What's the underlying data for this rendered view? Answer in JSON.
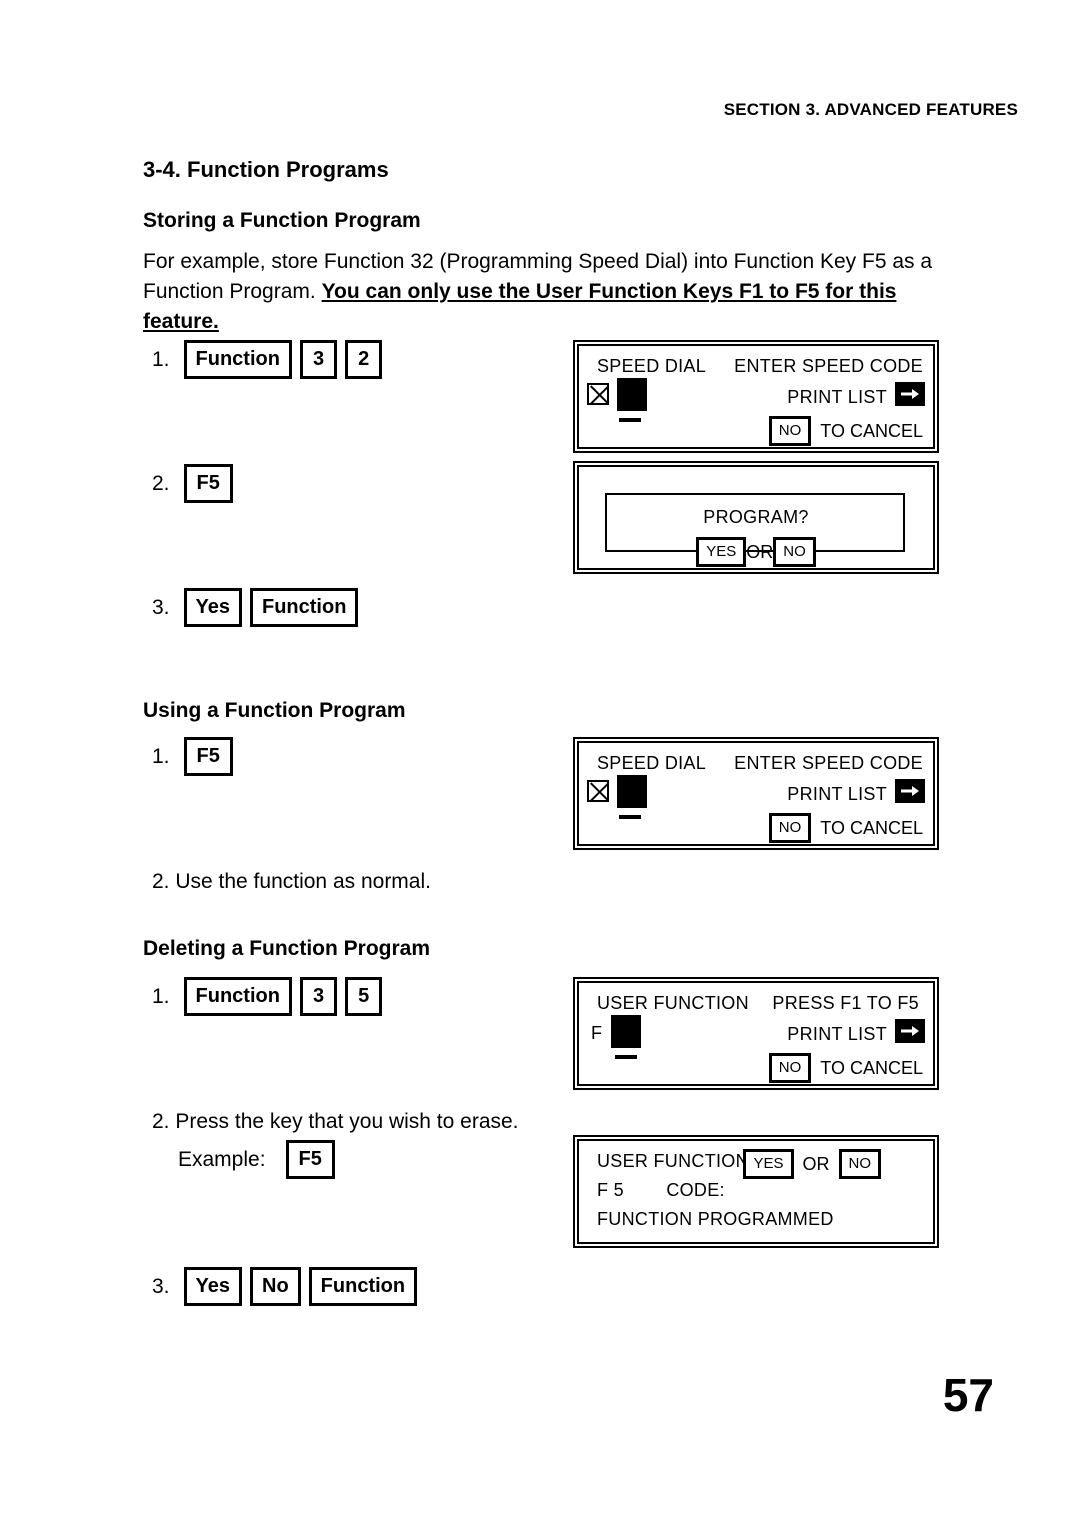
{
  "header": {
    "running_head": "SECTION 3. ADVANCED FEATURES"
  },
  "headings": {
    "section": "3-4. Function Programs",
    "storing": "Storing a Function Program",
    "using": "Using a Function Program",
    "deleting": "Deleting a Function Program"
  },
  "intro": {
    "normal_1": "For example, store Function 32 (Programming Speed Dial) into Function Key F5 as a Function Program.",
    "bold_underlined": "You can only use the User Function Keys F1 to F5 for this feature."
  },
  "storing_steps": {
    "step1": {
      "num": "1.",
      "keys": [
        "Function",
        "3",
        "2"
      ]
    },
    "step2": {
      "num": "2.",
      "keys": [
        "F5"
      ]
    },
    "step3": {
      "num": "3.",
      "keys": [
        "Yes",
        "Function"
      ]
    }
  },
  "using_steps": {
    "step1": {
      "num": "1.",
      "keys": [
        "F5"
      ]
    },
    "step2": "2. Use the function as normal."
  },
  "deleting_steps": {
    "step1": {
      "num": "1.",
      "keys": [
        "Function",
        "3",
        "5"
      ]
    },
    "step2_line1": "2. Press the key that you wish to erase.",
    "step2_line2_label": "Example:",
    "step2_line2_key": "F5",
    "step3": {
      "num": "3.",
      "keys": [
        "Yes",
        "No",
        "Function"
      ]
    }
  },
  "displays": {
    "speed_dial_1": {
      "title": "SPEED DIAL",
      "prompt": "ENTER SPEED CODE",
      "print_list": "PRINT LIST",
      "cancel_key": "NO",
      "cancel_text": "TO CANCEL",
      "icon": "x-in-box-icon",
      "arrow": "right-arrow-icon"
    },
    "program_confirm": {
      "question": "PROGRAM?",
      "yes": "YES",
      "or": "OR",
      "no": "NO"
    },
    "speed_dial_2": {
      "title": "SPEED DIAL",
      "prompt": "ENTER SPEED CODE",
      "print_list": "PRINT LIST",
      "cancel_key": "NO",
      "cancel_text": "TO CANCEL",
      "icon": "x-in-box-icon",
      "arrow": "right-arrow-icon"
    },
    "user_function": {
      "title": "USER FUNCTION",
      "prompt": "PRESS F1  TO F5",
      "field_prefix": "F",
      "print_list": "PRINT LIST",
      "cancel_key": "NO",
      "cancel_text": "TO CANCEL",
      "arrow": "right-arrow-icon"
    },
    "function_programmed": {
      "title": "USER FUNCTION",
      "yes": "YES",
      "or": "OR",
      "no": "NO",
      "key_line": "F 5        CODE:",
      "status": "FUNCTION PROGRAMMED"
    }
  },
  "footer": {
    "page_number": "57"
  }
}
